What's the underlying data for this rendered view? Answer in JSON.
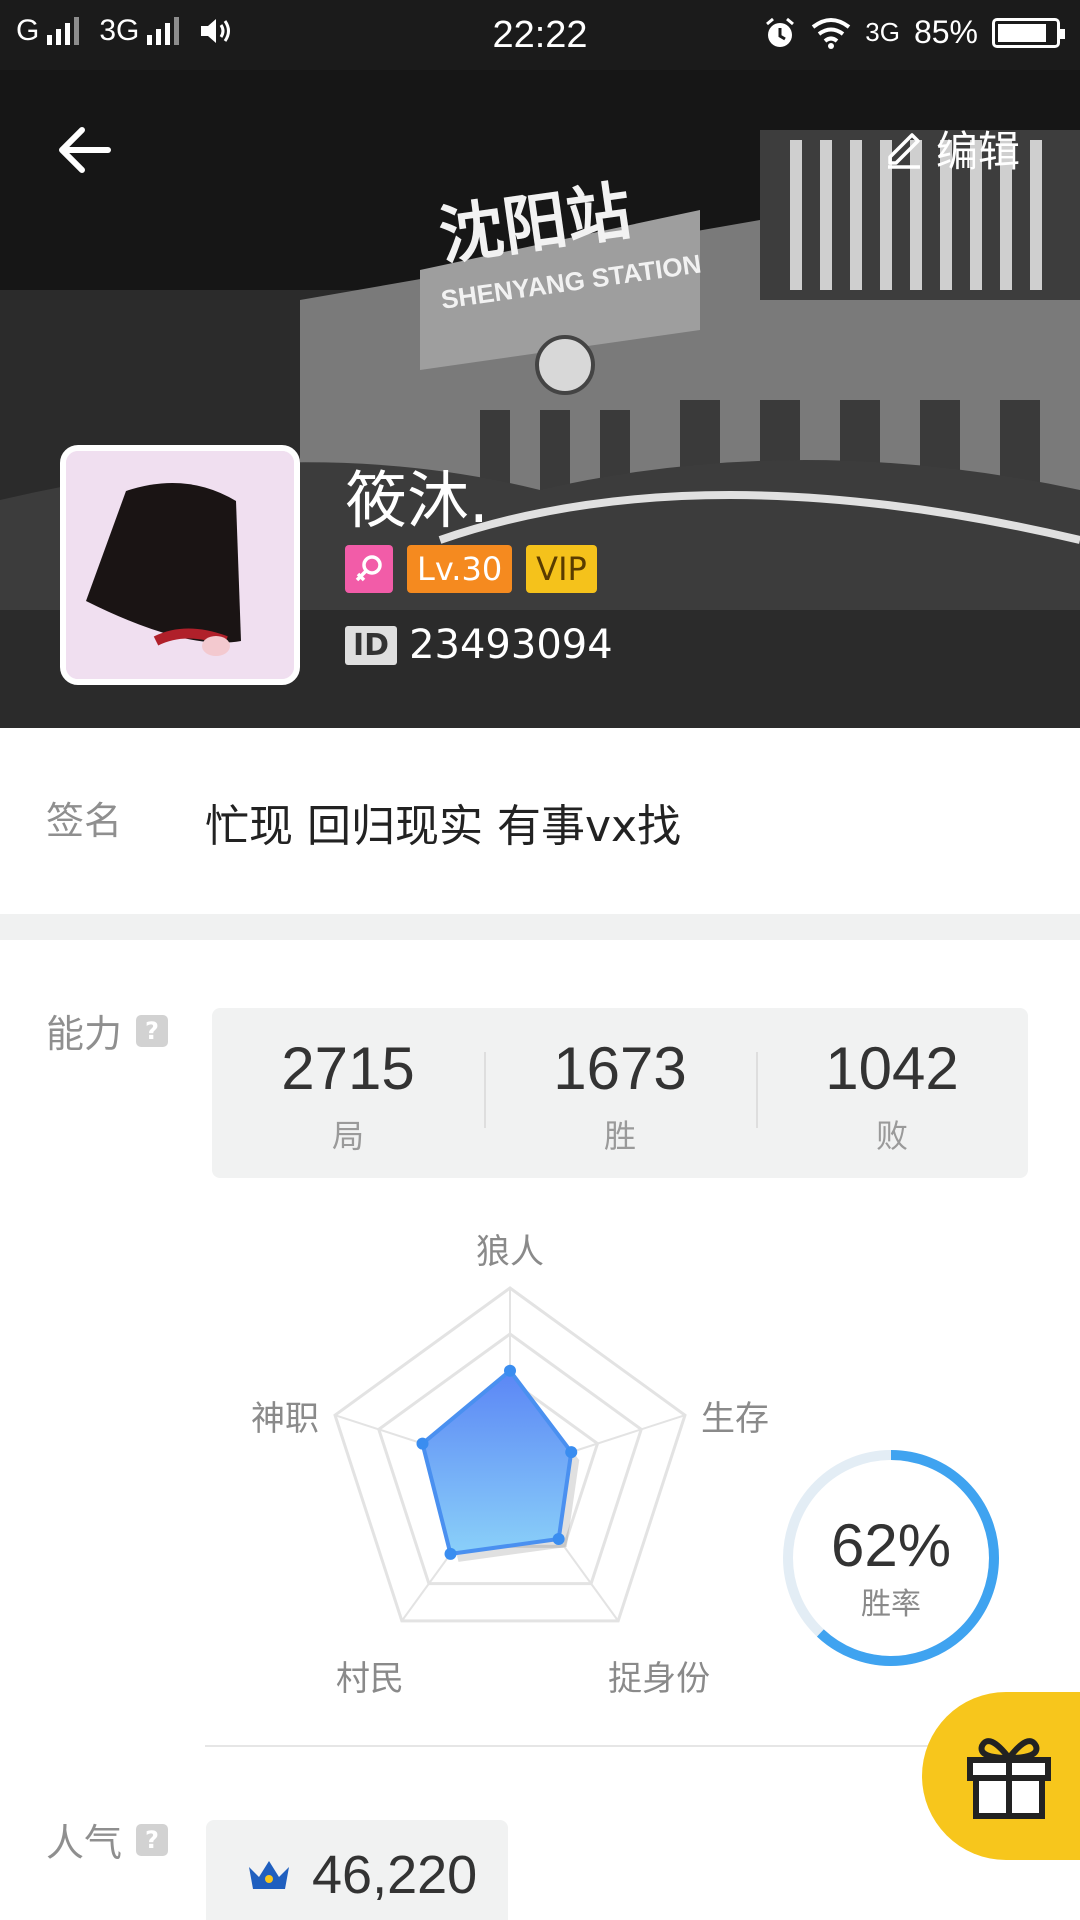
{
  "status_bar": {
    "carrier1": "G",
    "carrier2": "3G",
    "time": "22:22",
    "network": "3G",
    "battery": "85%",
    "battery_level": 0.85
  },
  "header": {
    "edit_label": "编辑",
    "banner_text": "沈阳站",
    "banner_subtext": "SHENYANG STATION"
  },
  "profile": {
    "nickname": "筱沐.",
    "level": "Lv.30",
    "vip": "VIP",
    "id_tag": "ID",
    "id": "23493094"
  },
  "signature": {
    "label": "签名",
    "text": "忙现 回归现实 有事vx找"
  },
  "ability": {
    "label": "能力",
    "help": "?",
    "stats": [
      {
        "value": "2715",
        "unit": "局"
      },
      {
        "value": "1673",
        "unit": "胜"
      },
      {
        "value": "1042",
        "unit": "败"
      }
    ]
  },
  "chart_data": {
    "type": "radar",
    "axes": [
      "狼人",
      "生存",
      "捉身份",
      "村民",
      "神职"
    ],
    "values": [
      0.55,
      0.35,
      0.45,
      0.55,
      0.5
    ],
    "range": [
      0,
      1
    ],
    "color": "#4a90f0"
  },
  "winrate": {
    "value": "62%",
    "label": "胜率",
    "fraction": 0.62,
    "color": "#3fa3f0"
  },
  "popularity": {
    "label": "人气",
    "help": "?",
    "value": "46,220"
  }
}
